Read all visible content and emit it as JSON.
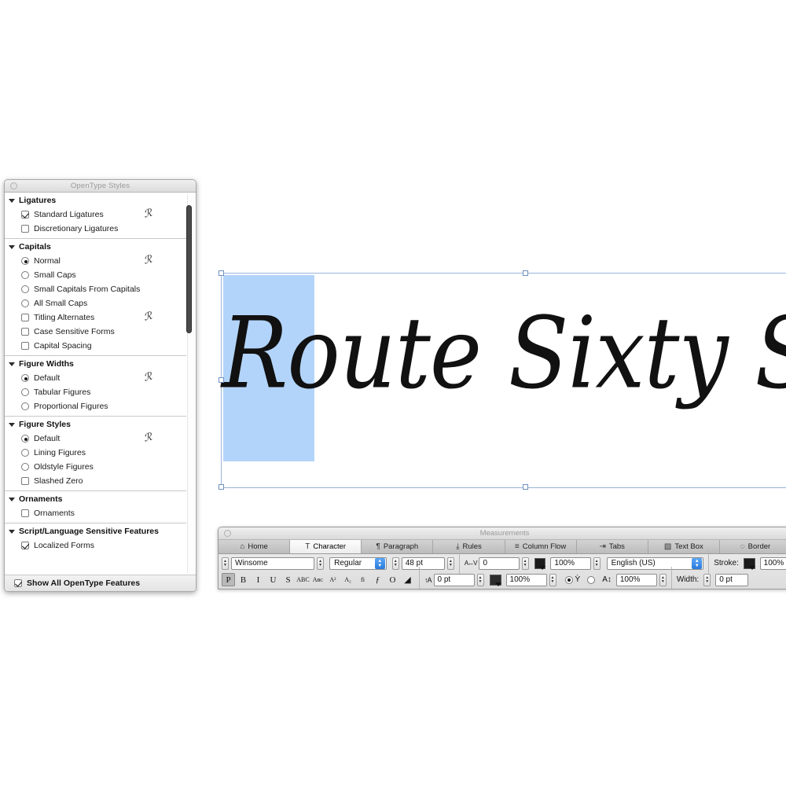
{
  "opentype_panel": {
    "title": "OpenType Styles",
    "close_icon": "close-circle-icon",
    "script_mark": "ℛ",
    "groups": [
      {
        "name": "Ligatures",
        "options": [
          {
            "label": "Standard Ligatures",
            "type": "checkbox",
            "checked": true,
            "has_mark": true
          },
          {
            "label": "Discretionary Ligatures",
            "type": "checkbox",
            "checked": false,
            "has_mark": false
          }
        ]
      },
      {
        "name": "Capitals",
        "options": [
          {
            "label": "Normal",
            "type": "radio",
            "checked": true,
            "has_mark": true
          },
          {
            "label": "Small Caps",
            "type": "radio",
            "checked": false,
            "has_mark": false
          },
          {
            "label": "Small Capitals From Capitals",
            "type": "radio",
            "checked": false,
            "has_mark": false
          },
          {
            "label": "All Small Caps",
            "type": "radio",
            "checked": false,
            "has_mark": false
          },
          {
            "label": "Titling Alternates",
            "type": "checkbox",
            "checked": false,
            "has_mark": true
          },
          {
            "label": "Case Sensitive Forms",
            "type": "checkbox",
            "checked": false,
            "has_mark": false
          },
          {
            "label": "Capital Spacing",
            "type": "checkbox",
            "checked": false,
            "has_mark": false
          }
        ]
      },
      {
        "name": "Figure Widths",
        "options": [
          {
            "label": "Default",
            "type": "radio",
            "checked": true,
            "has_mark": true
          },
          {
            "label": "Tabular Figures",
            "type": "radio",
            "checked": false,
            "has_mark": false
          },
          {
            "label": "Proportional Figures",
            "type": "radio",
            "checked": false,
            "has_mark": false
          }
        ]
      },
      {
        "name": "Figure Styles",
        "options": [
          {
            "label": "Default",
            "type": "radio",
            "checked": true,
            "has_mark": true
          },
          {
            "label": "Lining Figures",
            "type": "radio",
            "checked": false,
            "has_mark": false
          },
          {
            "label": "Oldstyle Figures",
            "type": "radio",
            "checked": false,
            "has_mark": false
          },
          {
            "label": "Slashed Zero",
            "type": "checkbox",
            "checked": false,
            "has_mark": false
          }
        ]
      },
      {
        "name": "Ornaments",
        "options": [
          {
            "label": "Ornaments",
            "type": "checkbox",
            "checked": false,
            "has_mark": false
          }
        ]
      },
      {
        "name": "Script/Language Sensitive Features",
        "options": [
          {
            "label": "Localized Forms",
            "type": "checkbox",
            "checked": true,
            "has_mark": false
          }
        ]
      }
    ],
    "footer": {
      "label": "Show All OpenType Features",
      "checked": true
    }
  },
  "canvas": {
    "text": "Route Sixty Six",
    "selection_color": "#b3d4fa",
    "frame_border_color": "#9ab4da",
    "handle_count": 6
  },
  "measurements": {
    "title": "Measurements",
    "close_icon": "close-circle-icon",
    "tabs": [
      {
        "label": "Home",
        "icon": "home-icon",
        "glyph": "⌂",
        "active": false
      },
      {
        "label": "Character",
        "icon": "character-t-icon",
        "glyph": "T",
        "active": true
      },
      {
        "label": "Paragraph",
        "icon": "pilcrow-icon",
        "glyph": "¶",
        "active": false
      },
      {
        "label": "Rules",
        "icon": "rules-icon",
        "glyph": "⤓",
        "active": false
      },
      {
        "label": "Column Flow",
        "icon": "column-flow-icon",
        "glyph": "≡",
        "active": false
      },
      {
        "label": "Tabs",
        "icon": "tabs-arrow-icon",
        "glyph": "⇥",
        "active": false
      },
      {
        "label": "Text Box",
        "icon": "text-box-icon",
        "glyph": "▧",
        "active": false
      },
      {
        "label": "Border",
        "icon": "border-icon",
        "glyph": "◌",
        "active": false
      }
    ],
    "character": {
      "font_family": "Winsome",
      "font_style": "Regular",
      "font_size": "48 pt",
      "tracking_icon": "tracking-icon",
      "tracking_value": "0",
      "baseline_icon": "baseline-shift-icon",
      "baseline_value": "0 pt",
      "shade_icon": "shade-swatch-icon",
      "shade_value": "100%",
      "opacity_icon": "opacity-swatch-icon",
      "opacity_value": "100%",
      "language": "English (US)",
      "scale_horizontal_icon": "horizontal-scale-icon",
      "scale_vertical_icon": "vertical-scale-icon",
      "scale_value": "100%",
      "style_buttons": [
        {
          "name": "plain",
          "glyph": "P",
          "pressed": true
        },
        {
          "name": "bold",
          "glyph": "B",
          "pressed": false
        },
        {
          "name": "italic",
          "glyph": "I",
          "pressed": false
        },
        {
          "name": "underline",
          "glyph": "U",
          "pressed": false
        },
        {
          "name": "strikethrough",
          "glyph": "S",
          "pressed": false
        },
        {
          "name": "all-caps",
          "glyph": "ABC",
          "pressed": false
        },
        {
          "name": "small-caps",
          "glyph": "Aʙᴄ",
          "pressed": false
        },
        {
          "name": "superscript",
          "glyph": "A²",
          "pressed": false
        },
        {
          "name": "subscript",
          "glyph": "A₂",
          "pressed": false
        },
        {
          "name": "ligature",
          "glyph": "fi",
          "pressed": false
        },
        {
          "name": "font-script",
          "glyph": "ƒ",
          "pressed": false
        },
        {
          "name": "outline",
          "glyph": "O",
          "pressed": false
        },
        {
          "name": "shadow",
          "glyph": "◢",
          "pressed": false
        }
      ]
    },
    "border": {
      "stroke_label": "Stroke:",
      "stroke_icon": "stroke-swatch-icon",
      "stroke_value": "100%",
      "width_label": "Width:",
      "width_value": "0 pt"
    }
  }
}
